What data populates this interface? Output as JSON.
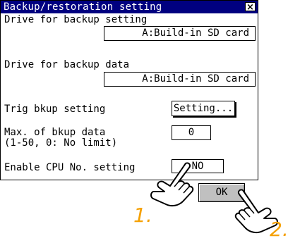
{
  "dialog": {
    "title": "Backup/restoration setting",
    "close_glyph": "×",
    "backup_setting_drive": {
      "label": "Drive for backup setting",
      "value": "A:Build-in SD card"
    },
    "backup_data_drive": {
      "label": "Drive for backup data",
      "value": "A:Build-in SD card"
    },
    "trig_bkup": {
      "label": "Trig bkup setting",
      "button": "Setting..."
    },
    "max_bkup": {
      "label_line1": "Max. of bkup data",
      "label_line2": "(1-50, 0: No limit)",
      "value": "0"
    },
    "enable_cpu": {
      "label": "Enable CPU No. setting",
      "value": "NO"
    },
    "ok_label": "OK"
  },
  "annotations": {
    "step1": "1.",
    "step2": "2.",
    "hand_icon": "pointing-hand-icon",
    "step_color": "#f5a000"
  }
}
